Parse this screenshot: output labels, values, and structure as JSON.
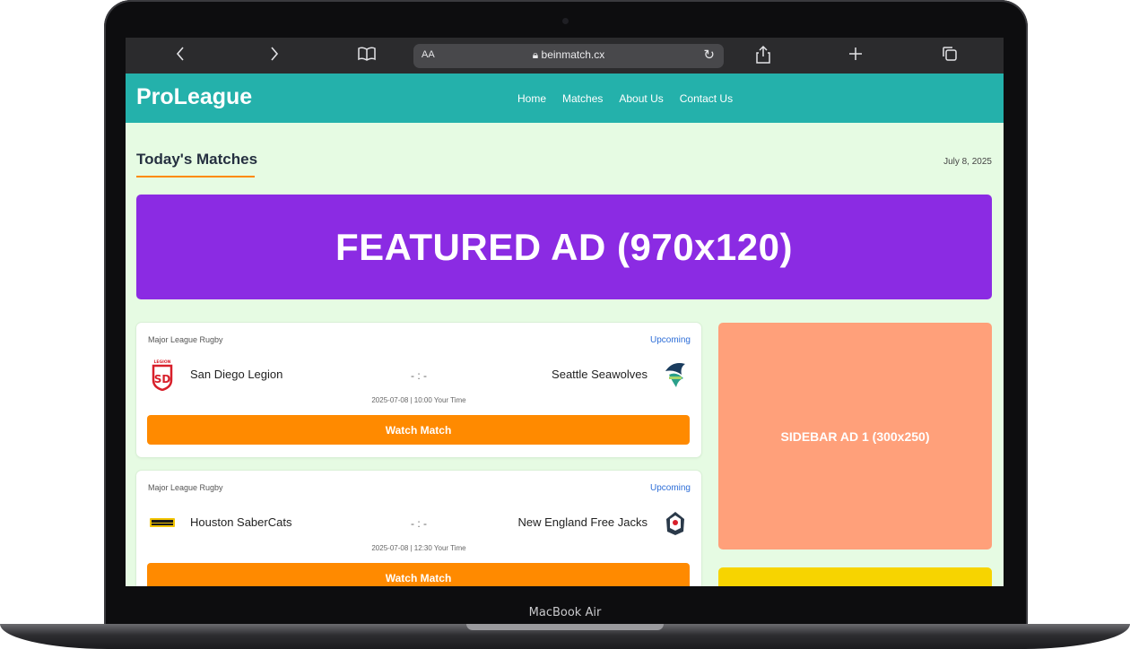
{
  "device": {
    "label": "MacBook Air"
  },
  "browser": {
    "back_icon": "‹",
    "forward_icon": "›",
    "aa_label": "AA",
    "url": "beinmatch.cx"
  },
  "site": {
    "logo": "ProLeague",
    "nav": [
      "Home",
      "Matches",
      "About Us",
      "Contact Us"
    ]
  },
  "page": {
    "section_title": "Today's Matches",
    "date": "July 8, 2025"
  },
  "ads": {
    "featured": "FEATURED AD (970x120)",
    "sidebar1": "SIDEBAR AD 1 (300x250)"
  },
  "matches": [
    {
      "league": "Major League Rugby",
      "status": "Upcoming",
      "home": "San Diego Legion",
      "away": "Seattle Seawolves",
      "score": "- : -",
      "time": "2025-07-08 | 10:00 Your Time",
      "button": "Watch Match"
    },
    {
      "league": "Major League Rugby",
      "status": "Upcoming",
      "home": "Houston SaberCats",
      "away": "New England Free Jacks",
      "score": "- : -",
      "time": "2025-07-08 | 12:30 Your Time",
      "button": "Watch Match"
    }
  ],
  "colors": {
    "header": "#24b1ab",
    "accent": "#ff8a00",
    "featured_ad": "#8b2be3",
    "sidebar_ad": "#ffa07a",
    "sidebar_ad_2": "#f7d400",
    "status": "#2f6fd8"
  }
}
